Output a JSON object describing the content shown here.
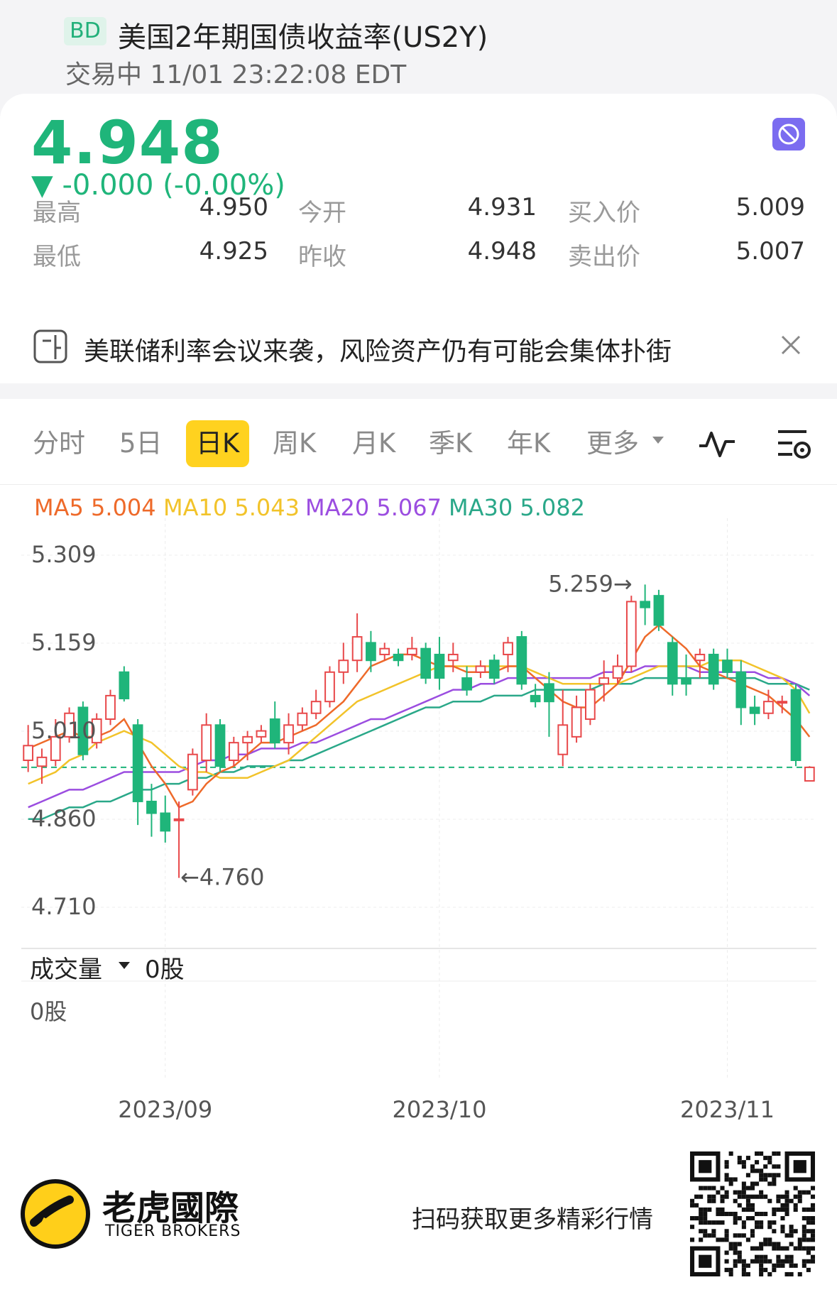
{
  "header": {
    "badge": "BD",
    "title": "美国2年期国债收益率(US2Y)",
    "status_time": "交易中 11/01 23:22:08 EDT"
  },
  "quote": {
    "price": "4.948",
    "change": "▼ -0.000 (-0.00%)",
    "stats": [
      {
        "label": "最高",
        "value": "4.950"
      },
      {
        "label": "今开",
        "value": "4.931"
      },
      {
        "label": "买入价",
        "value": "5.009"
      },
      {
        "label": "最低",
        "value": "4.925"
      },
      {
        "label": "昨收",
        "value": "4.948"
      },
      {
        "label": "卖出价",
        "value": "5.007"
      }
    ],
    "colors": {
      "down": "#1fb57a",
      "up": "#e8484a"
    }
  },
  "news": {
    "text": "美联储利率会议来袭，风险资产仍有可能会集体扑街"
  },
  "tabs": {
    "items": [
      "分时",
      "5日",
      "日K",
      "周K",
      "月K",
      "季K",
      "年K"
    ],
    "more": "更多",
    "active": "日K"
  },
  "ma_legend": [
    {
      "label": "MA5 5.004",
      "color": "#ee6a2a"
    },
    {
      "label": "MA10 5.043",
      "color": "#f2c32a"
    },
    {
      "label": "MA20 5.067",
      "color": "#9b4de0"
    },
    {
      "label": "MA30 5.082",
      "color": "#2aa889"
    }
  ],
  "chart_data": {
    "type": "candlestick",
    "y_ticks": [
      "5.309",
      "5.159",
      "5.010",
      "4.860",
      "4.710"
    ],
    "ylim": [
      4.71,
      5.309
    ],
    "x_ticks": [
      {
        "label": "2023/09",
        "index": 10
      },
      {
        "label": "2023/10",
        "index": 30
      },
      {
        "label": "2023/11",
        "index": 51
      }
    ],
    "annotations": {
      "high": "5.259",
      "low": "4.760"
    },
    "last_close": 4.948,
    "candles": [
      {
        "o": 4.96,
        "h": 5.02,
        "l": 4.94,
        "c": 4.985
      },
      {
        "o": 4.95,
        "h": 4.98,
        "l": 4.92,
        "c": 4.965
      },
      {
        "o": 4.96,
        "h": 5.03,
        "l": 4.95,
        "c": 5.0
      },
      {
        "o": 5.0,
        "h": 5.05,
        "l": 4.99,
        "c": 5.04
      },
      {
        "o": 5.05,
        "h": 5.06,
        "l": 4.96,
        "c": 4.97
      },
      {
        "o": 4.99,
        "h": 5.04,
        "l": 4.98,
        "c": 5.03
      },
      {
        "o": 5.03,
        "h": 5.08,
        "l": 5.02,
        "c": 5.07
      },
      {
        "o": 5.11,
        "h": 5.12,
        "l": 5.06,
        "c": 5.065
      },
      {
        "o": 5.02,
        "h": 5.03,
        "l": 4.85,
        "c": 4.89
      },
      {
        "o": 4.89,
        "h": 4.92,
        "l": 4.83,
        "c": 4.87
      },
      {
        "o": 4.87,
        "h": 4.9,
        "l": 4.82,
        "c": 4.84
      },
      {
        "o": 4.86,
        "h": 4.89,
        "l": 4.76,
        "c": 4.86
      },
      {
        "o": 4.91,
        "h": 4.98,
        "l": 4.9,
        "c": 4.97
      },
      {
        "o": 4.96,
        "h": 5.04,
        "l": 4.94,
        "c": 5.02
      },
      {
        "o": 5.02,
        "h": 5.03,
        "l": 4.94,
        "c": 4.95
      },
      {
        "o": 4.96,
        "h": 5.0,
        "l": 4.95,
        "c": 4.99
      },
      {
        "o": 4.99,
        "h": 5.01,
        "l": 4.96,
        "c": 5.0
      },
      {
        "o": 5.0,
        "h": 5.02,
        "l": 4.99,
        "c": 5.01
      },
      {
        "o": 5.03,
        "h": 5.06,
        "l": 4.98,
        "c": 4.99
      },
      {
        "o": 4.99,
        "h": 5.04,
        "l": 4.97,
        "c": 5.02
      },
      {
        "o": 5.02,
        "h": 5.05,
        "l": 5.01,
        "c": 5.04
      },
      {
        "o": 5.04,
        "h": 5.08,
        "l": 5.03,
        "c": 5.06
      },
      {
        "o": 5.06,
        "h": 5.12,
        "l": 5.05,
        "c": 5.11
      },
      {
        "o": 5.11,
        "h": 5.16,
        "l": 5.09,
        "c": 5.13
      },
      {
        "o": 5.13,
        "h": 5.21,
        "l": 5.11,
        "c": 5.17
      },
      {
        "o": 5.16,
        "h": 5.18,
        "l": 5.11,
        "c": 5.13
      },
      {
        "o": 5.14,
        "h": 5.16,
        "l": 5.13,
        "c": 5.15
      },
      {
        "o": 5.14,
        "h": 5.15,
        "l": 5.12,
        "c": 5.13
      },
      {
        "o": 5.14,
        "h": 5.17,
        "l": 5.13,
        "c": 5.15
      },
      {
        "o": 5.15,
        "h": 5.16,
        "l": 5.09,
        "c": 5.1
      },
      {
        "o": 5.14,
        "h": 5.17,
        "l": 5.08,
        "c": 5.1
      },
      {
        "o": 5.13,
        "h": 5.16,
        "l": 5.11,
        "c": 5.14
      },
      {
        "o": 5.1,
        "h": 5.12,
        "l": 5.07,
        "c": 5.08
      },
      {
        "o": 5.11,
        "h": 5.13,
        "l": 5.1,
        "c": 5.12
      },
      {
        "o": 5.13,
        "h": 5.14,
        "l": 5.09,
        "c": 5.1
      },
      {
        "o": 5.14,
        "h": 5.17,
        "l": 5.11,
        "c": 5.16
      },
      {
        "o": 5.17,
        "h": 5.18,
        "l": 5.08,
        "c": 5.09
      },
      {
        "o": 5.07,
        "h": 5.09,
        "l": 5.05,
        "c": 5.06
      },
      {
        "o": 5.09,
        "h": 5.11,
        "l": 5.0,
        "c": 5.06
      },
      {
        "o": 4.97,
        "h": 5.08,
        "l": 4.95,
        "c": 5.02
      },
      {
        "o": 5.0,
        "h": 5.07,
        "l": 4.99,
        "c": 5.05
      },
      {
        "o": 5.03,
        "h": 5.09,
        "l": 5.02,
        "c": 5.08
      },
      {
        "o": 5.09,
        "h": 5.13,
        "l": 5.06,
        "c": 5.1
      },
      {
        "o": 5.1,
        "h": 5.14,
        "l": 5.09,
        "c": 5.12
      },
      {
        "o": 5.12,
        "h": 5.24,
        "l": 5.11,
        "c": 5.23
      },
      {
        "o": 5.23,
        "h": 5.259,
        "l": 5.19,
        "c": 5.22
      },
      {
        "o": 5.24,
        "h": 5.25,
        "l": 5.18,
        "c": 5.19
      },
      {
        "o": 5.16,
        "h": 5.17,
        "l": 5.07,
        "c": 5.09
      },
      {
        "o": 5.1,
        "h": 5.14,
        "l": 5.07,
        "c": 5.09
      },
      {
        "o": 5.13,
        "h": 5.15,
        "l": 5.1,
        "c": 5.14
      },
      {
        "o": 5.14,
        "h": 5.15,
        "l": 5.08,
        "c": 5.09
      },
      {
        "o": 5.13,
        "h": 5.15,
        "l": 5.1,
        "c": 5.11
      },
      {
        "o": 5.11,
        "h": 5.13,
        "l": 5.02,
        "c": 5.05
      },
      {
        "o": 5.05,
        "h": 5.07,
        "l": 5.02,
        "c": 5.04
      },
      {
        "o": 5.04,
        "h": 5.08,
        "l": 5.03,
        "c": 5.06
      },
      {
        "o": 5.06,
        "h": 5.07,
        "l": 5.04,
        "c": 5.06
      },
      {
        "o": 5.08,
        "h": 5.09,
        "l": 4.95,
        "c": 4.96
      },
      {
        "o": 4.925,
        "h": 4.95,
        "l": 4.925,
        "c": 4.948
      }
    ],
    "ma5": [
      4.98,
      4.99,
      5.0,
      5.01,
      5.0,
      5.0,
      5.01,
      5.03,
      4.99,
      4.95,
      4.92,
      4.88,
      4.89,
      4.92,
      4.94,
      4.95,
      4.97,
      4.99,
      4.99,
      5.0,
      5.01,
      5.02,
      5.04,
      5.06,
      5.09,
      5.12,
      5.13,
      5.14,
      5.14,
      5.13,
      5.12,
      5.12,
      5.11,
      5.11,
      5.11,
      5.12,
      5.12,
      5.1,
      5.08,
      5.06,
      5.05,
      5.05,
      5.07,
      5.09,
      5.13,
      5.17,
      5.19,
      5.17,
      5.15,
      5.12,
      5.11,
      5.1,
      5.09,
      5.08,
      5.07,
      5.05,
      5.03,
      5.0
    ],
    "ma10": [
      4.92,
      4.93,
      4.94,
      4.96,
      4.97,
      4.99,
      5.0,
      5.01,
      5.0,
      4.99,
      4.97,
      4.95,
      4.94,
      4.94,
      4.93,
      4.93,
      4.93,
      4.94,
      4.95,
      4.96,
      4.98,
      5.0,
      5.02,
      5.04,
      5.06,
      5.07,
      5.08,
      5.09,
      5.1,
      5.11,
      5.12,
      5.12,
      5.12,
      5.12,
      5.12,
      5.12,
      5.12,
      5.11,
      5.1,
      5.09,
      5.09,
      5.09,
      5.09,
      5.09,
      5.1,
      5.11,
      5.12,
      5.12,
      5.12,
      5.12,
      5.13,
      5.13,
      5.13,
      5.12,
      5.11,
      5.1,
      5.08,
      5.04
    ],
    "ma20": [
      4.88,
      4.89,
      4.9,
      4.91,
      4.91,
      4.92,
      4.93,
      4.94,
      4.94,
      4.94,
      4.94,
      4.94,
      4.95,
      4.96,
      4.96,
      4.97,
      4.97,
      4.98,
      4.98,
      4.98,
      4.99,
      4.99,
      5.0,
      5.01,
      5.02,
      5.03,
      5.03,
      5.04,
      5.05,
      5.06,
      5.07,
      5.08,
      5.08,
      5.09,
      5.09,
      5.1,
      5.1,
      5.1,
      5.1,
      5.1,
      5.1,
      5.1,
      5.11,
      5.11,
      5.11,
      5.12,
      5.12,
      5.12,
      5.12,
      5.11,
      5.11,
      5.11,
      5.11,
      5.11,
      5.1,
      5.1,
      5.09,
      5.07
    ],
    "ma30": [
      4.86,
      4.86,
      4.87,
      4.88,
      4.88,
      4.89,
      4.89,
      4.9,
      4.91,
      4.91,
      4.92,
      4.92,
      4.93,
      4.93,
      4.94,
      4.94,
      4.95,
      4.95,
      4.95,
      4.96,
      4.96,
      4.97,
      4.98,
      4.99,
      5.0,
      5.01,
      5.02,
      5.03,
      5.04,
      5.05,
      5.05,
      5.06,
      5.06,
      5.06,
      5.07,
      5.07,
      5.07,
      5.08,
      5.08,
      5.08,
      5.08,
      5.08,
      5.09,
      5.09,
      5.09,
      5.1,
      5.1,
      5.1,
      5.1,
      5.1,
      5.1,
      5.1,
      5.1,
      5.1,
      5.09,
      5.09,
      5.09,
      5.08
    ]
  },
  "volume": {
    "label": "成交量",
    "value": "0股",
    "axis_value": "0股"
  },
  "footer": {
    "brand_cn": "老虎國際",
    "brand_en": "TIGER BROKERS",
    "scan_text": "扫码获取更多精彩行情"
  }
}
